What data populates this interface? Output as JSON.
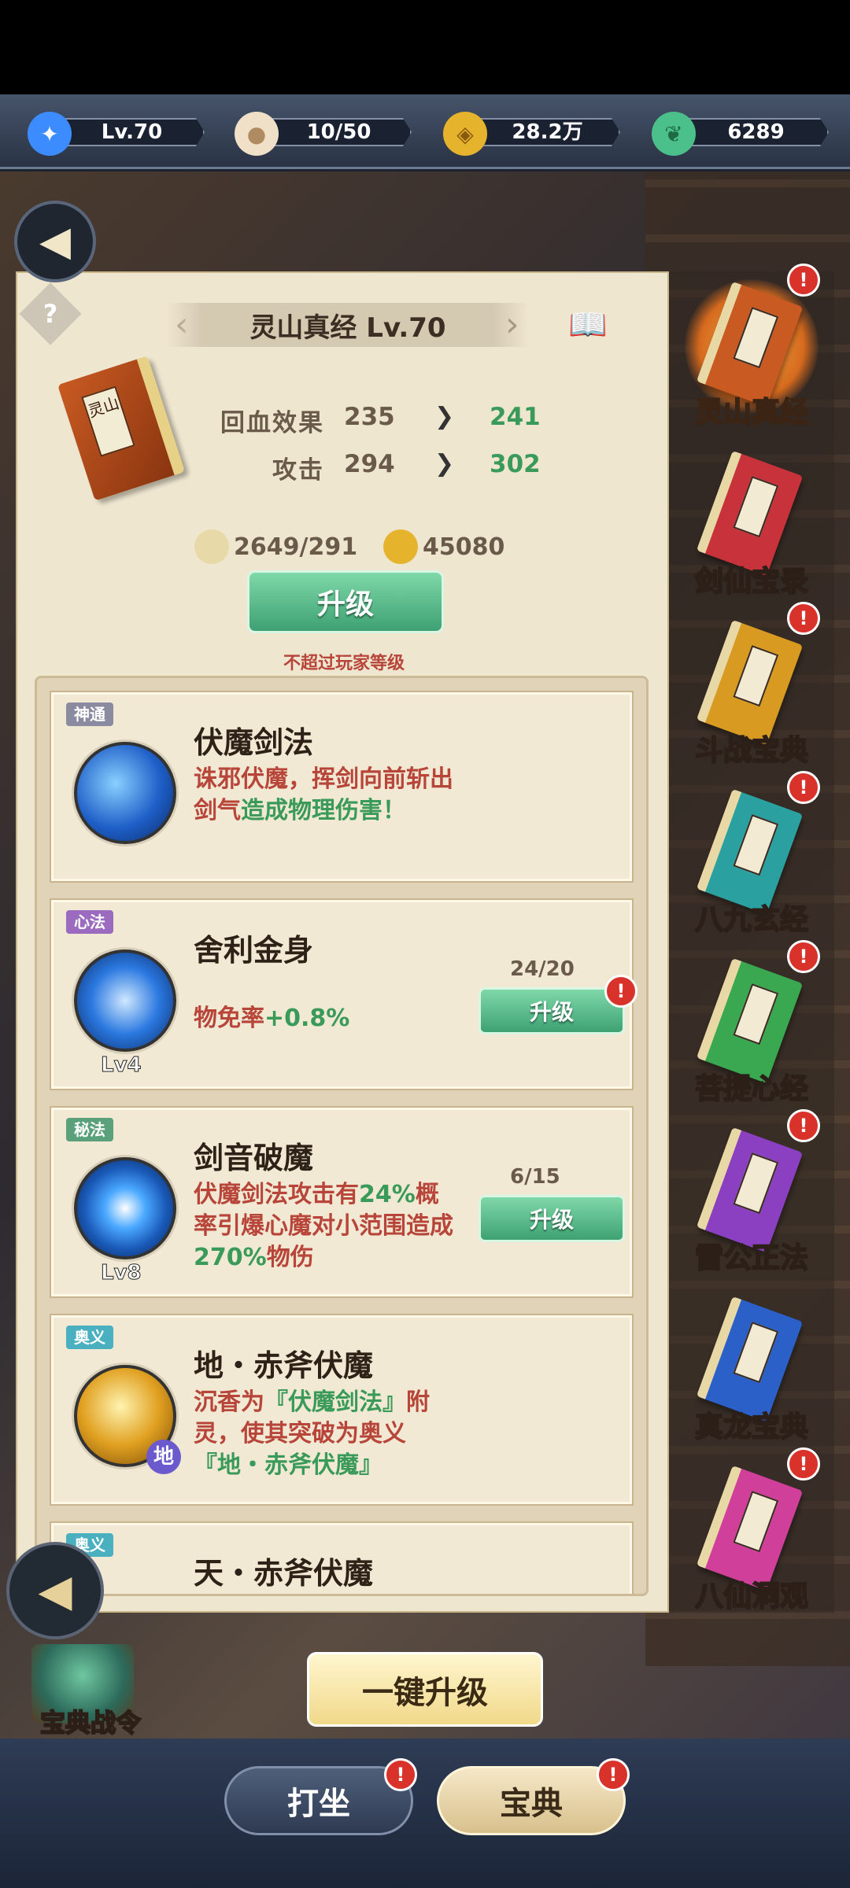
{
  "resources": [
    {
      "icon": "spirit-icon",
      "value": "Lv.70",
      "color": "#3c8cff"
    },
    {
      "icon": "bun-icon",
      "value": "10/50",
      "color": "#f0e0c8"
    },
    {
      "icon": "coin-icon",
      "value": "28.2万",
      "color": "#e6b42c"
    },
    {
      "icon": "jade-leaf-icon",
      "value": "6289",
      "color": "#4cc08a"
    }
  ],
  "book": {
    "title": "灵山真经 Lv.70",
    "cover_text": "灵山",
    "stats": [
      {
        "name": "回血效果",
        "old": "235",
        "new": "241"
      },
      {
        "name": "攻击",
        "old": "294",
        "new": "302"
      }
    ],
    "cost_scroll": "2649/291",
    "cost_coin": "45080",
    "upgrade_label": "升级",
    "limit_note": "不超过玩家等级"
  },
  "skills": [
    {
      "tag": "神通",
      "tag_color": "#8a8aa0",
      "name": "伏魔剑法",
      "level": "",
      "desc_parts": [
        "诛邪伏魔，挥剑向前斩出剑气",
        "造成物理伤害！"
      ],
      "progress": "",
      "button": "",
      "orb": "#1e5fc8"
    },
    {
      "tag": "心法",
      "tag_color": "#9b6bc0",
      "name": "舍利金身",
      "level": "Lv4",
      "desc_parts": [
        "物免率",
        "+0.8%"
      ],
      "progress": "24/20",
      "button": "升级",
      "orb": "#2a78e0"
    },
    {
      "tag": "秘法",
      "tag_color": "#5aa07a",
      "name": "剑音破魔",
      "level": "Lv8",
      "desc_parts": [
        "伏魔剑法攻击有",
        "24%",
        "概率引爆心魔对小范围造成",
        "270%",
        "物伤"
      ],
      "progress": "6/15",
      "button": "升级",
      "orb": "#1a5ab8"
    },
    {
      "tag": "奥义",
      "tag_color": "#4ab0c0",
      "name": "地・赤斧伏魔",
      "level": "",
      "desc_parts": [
        "沉香为",
        "『伏魔剑法』",
        "附灵，使其突破为奥义",
        "『地・赤斧伏魔』"
      ],
      "progress": "",
      "button": "",
      "orb": "#e0a020",
      "orb_badge": "地"
    },
    {
      "tag": "奥义",
      "tag_color": "#4ab0c0",
      "name": "天・赤斧伏魔",
      "level": "",
      "desc_parts": [
        "",
        "",
        "",
        ""
      ],
      "progress": "",
      "button": "",
      "orb": "#e0a020"
    }
  ],
  "sidebar": [
    {
      "label": "灵山真经",
      "color": "#c85a22",
      "badge": "!",
      "active": true
    },
    {
      "label": "剑仙宝录",
      "color": "#c8323a",
      "badge": "",
      "active": false
    },
    {
      "label": "斗战宝典",
      "color": "#d89a20",
      "badge": "!",
      "active": false
    },
    {
      "label": "八九玄经",
      "color": "#2aa0a0",
      "badge": "!",
      "active": false
    },
    {
      "label": "菩提心经",
      "color": "#3aa850",
      "badge": "!",
      "active": false
    },
    {
      "label": "雷公正法",
      "color": "#8a40c0",
      "badge": "!",
      "active": false
    },
    {
      "label": "真龙宝典",
      "color": "#2a60c8",
      "badge": "",
      "active": false
    },
    {
      "label": "八仙洞观",
      "color": "#d0409a",
      "badge": "!",
      "active": false
    }
  ],
  "bottom": {
    "pass_label": "宝典战令",
    "onekey_label": "一键升级",
    "tab_dazuo": "打坐",
    "tab_baodian": "宝典",
    "badge": "!"
  }
}
